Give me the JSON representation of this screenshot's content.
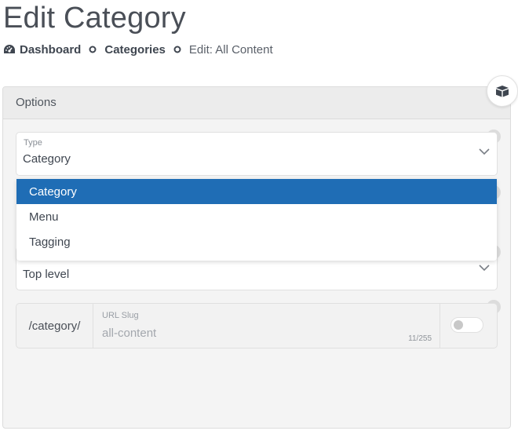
{
  "page": {
    "title": "Edit Category"
  },
  "breadcrumb": {
    "items": [
      {
        "label": "Dashboard",
        "icon": "dashboard-icon"
      },
      {
        "label": "Categories"
      }
    ],
    "current": "Edit: All Content"
  },
  "card": {
    "header": "Options"
  },
  "type_field": {
    "label": "Type",
    "value": "Category",
    "options": [
      "Category",
      "Menu",
      "Tagging"
    ],
    "selected_index": 0
  },
  "parent_field": {
    "value": "Top level"
  },
  "url": {
    "prefix": "/category/",
    "slug_label": "URL Slug",
    "slug_value": "all-content",
    "char_count": "11/255",
    "toggle_on": false
  },
  "help_glyph": "?",
  "colors": {
    "accent": "#1f6db5",
    "card_bg": "#f4f4f4",
    "header_bg": "#ececec"
  }
}
